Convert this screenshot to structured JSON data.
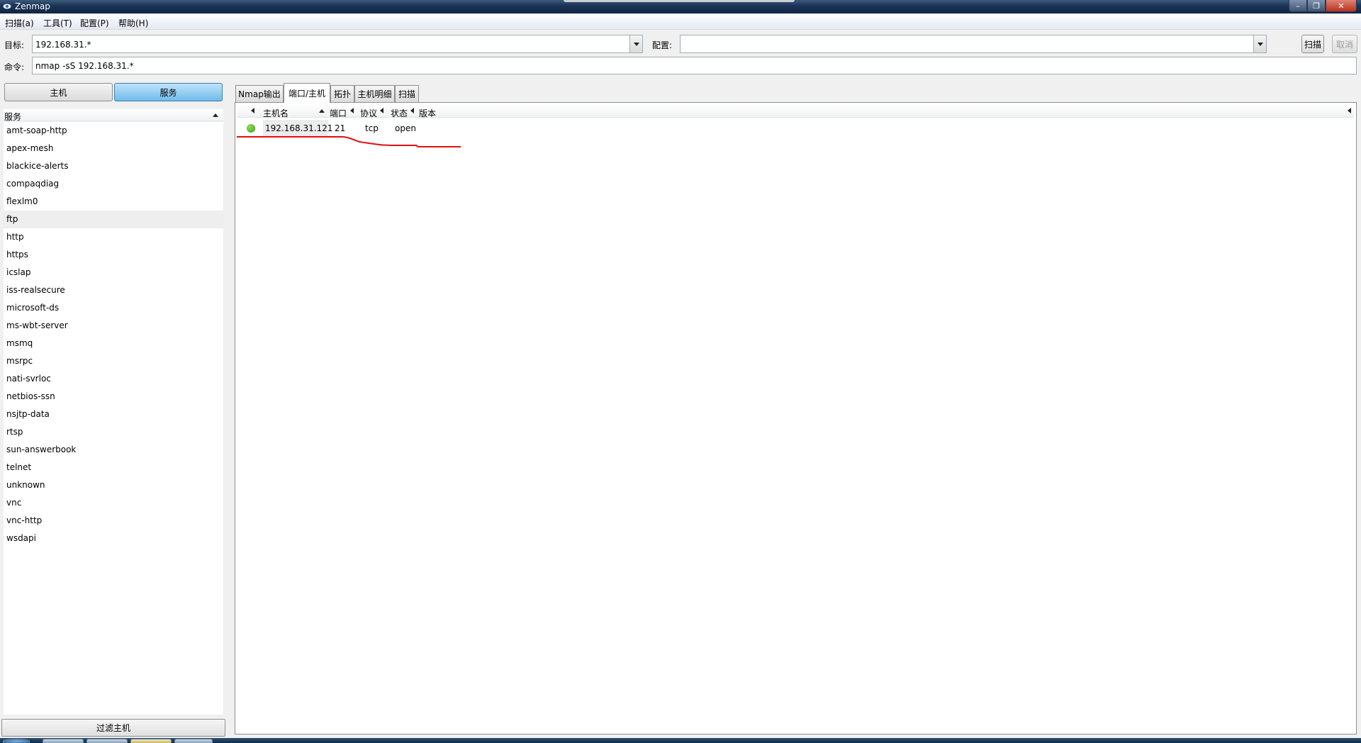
{
  "window": {
    "title": "Zenmap"
  },
  "menu": [
    "扫描(a)",
    "工具(T)",
    "配置(P)",
    "帮助(H)"
  ],
  "toolbar": {
    "target_label": "目标:",
    "target_value": "192.168.31.*",
    "profile_label": "配置:",
    "profile_value": "",
    "scan_button": "扫描",
    "cancel_button": "取消",
    "command_label": "命令:",
    "command_value": "nmap -sS 192.168.31.*"
  },
  "left_panel": {
    "hosts_button": "主机",
    "services_button": "服务",
    "list_header": "服务",
    "services": [
      "amt-soap-http",
      "apex-mesh",
      "blackice-alerts",
      "compaqdiag",
      "flexlm0",
      "ftp",
      "http",
      "https",
      "icslap",
      "iss-realsecure",
      "microsoft-ds",
      "ms-wbt-server",
      "msmq",
      "msrpc",
      "nati-svrloc",
      "netbios-ssn",
      "nsjtp-data",
      "rtsp",
      "sun-answerbook",
      "telnet",
      "unknown",
      "vnc",
      "vnc-http",
      "wsdapi"
    ],
    "selected_service": "ftp",
    "filter_button": "过滤主机"
  },
  "tabs": [
    "Nmap输出",
    "端口/主机",
    "拓扑",
    "主机明细",
    "扫描"
  ],
  "active_tab": "端口/主机",
  "table": {
    "columns": [
      "主机名",
      "端口",
      "协议",
      "状态",
      "版本"
    ],
    "rows": [
      {
        "host": "192.168.31.121",
        "port": "21",
        "protocol": "tcp",
        "state": "open",
        "version": ""
      }
    ]
  },
  "colors": {
    "annotation": "#e01010",
    "active_button": "#6fbcea",
    "status_up": "#3d9a1d"
  }
}
